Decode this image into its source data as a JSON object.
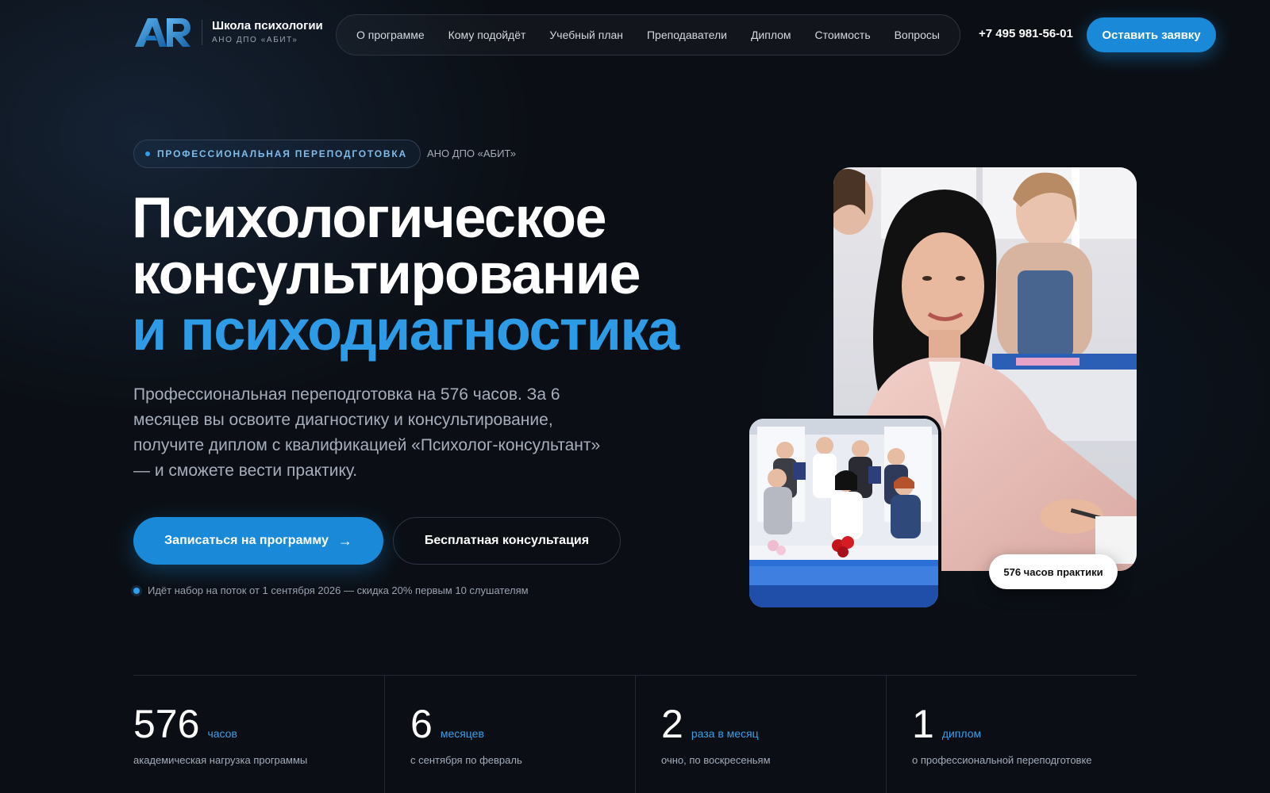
{
  "header": {
    "logo": {
      "mark": "AR",
      "title": "Школа психологии",
      "subtitle": "АНО ДПО «АБИТ»"
    },
    "menu": [
      "О программе",
      "Кому подойдёт",
      "Учебный план",
      "Преподаватели",
      "Диплом",
      "Стоимость",
      "Вопросы"
    ],
    "phone": "+7 495 981-56-01",
    "cta_label": "Оставить заявку"
  },
  "hero": {
    "pill_label": "ПРОФЕССИОНАЛЬНАЯ ПЕРЕПОДГОТОВКА",
    "org_label": "АНО ДПО «АБИТ»",
    "title_line1": "Психологическое",
    "title_line2": "консультирование",
    "title_line3": "и психодиагностика",
    "lead": "Профессиональная переподготовка на 576 часов. За 6 месяцев вы освоите диагностику и консультирование, получите диплом с квалификацией «Психолог-консультант» — и сможете вести практику.",
    "primary_button": "Записаться на программу",
    "primary_button_icon": "arrow-right-icon",
    "secondary_button": "Бесплатная консультация",
    "note": "Идёт набор на поток от 1 сентября 2026 — скидка 20% первым 10 слушателям",
    "photo_badge": "576 часов практики"
  },
  "stats": [
    {
      "value": "576",
      "unit": "часов",
      "desc": "академическая нагрузка программы"
    },
    {
      "value": "6",
      "unit": "месяцев",
      "desc": "с сентября по февраль"
    },
    {
      "value": "2",
      "unit": "раза в месяц",
      "desc": "очно, по воскресеньям"
    },
    {
      "value": "1",
      "unit": "диплом",
      "desc": "о профессиональной переподготовке"
    }
  ],
  "colors": {
    "background": "#0b0f15",
    "accent": "#2d9be6",
    "button": "#1a8ad8"
  }
}
